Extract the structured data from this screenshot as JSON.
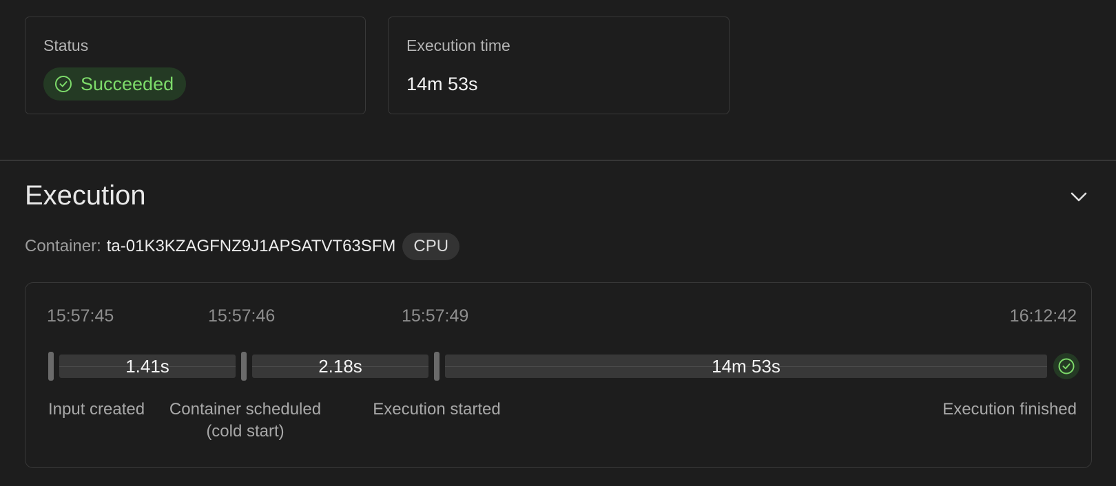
{
  "status_card": {
    "label": "Status",
    "badge": "Succeeded",
    "badge_color": "#7ddb6a"
  },
  "execution_time_card": {
    "label": "Execution time",
    "value": "14m 53s"
  },
  "execution": {
    "title": "Execution",
    "container_label": "Container:",
    "container_id": "ta-01K3KZAGFNZ9J1APSATVT63SFM",
    "chip": "CPU",
    "timeline": {
      "times": [
        "15:57:45",
        "15:57:46",
        "15:57:49",
        "16:12:42"
      ],
      "durations": [
        "1.41s",
        "2.18s",
        "14m 53s"
      ],
      "events": [
        "Input created",
        "Container scheduled",
        "(cold start)",
        "Execution started",
        "Execution finished"
      ]
    }
  }
}
